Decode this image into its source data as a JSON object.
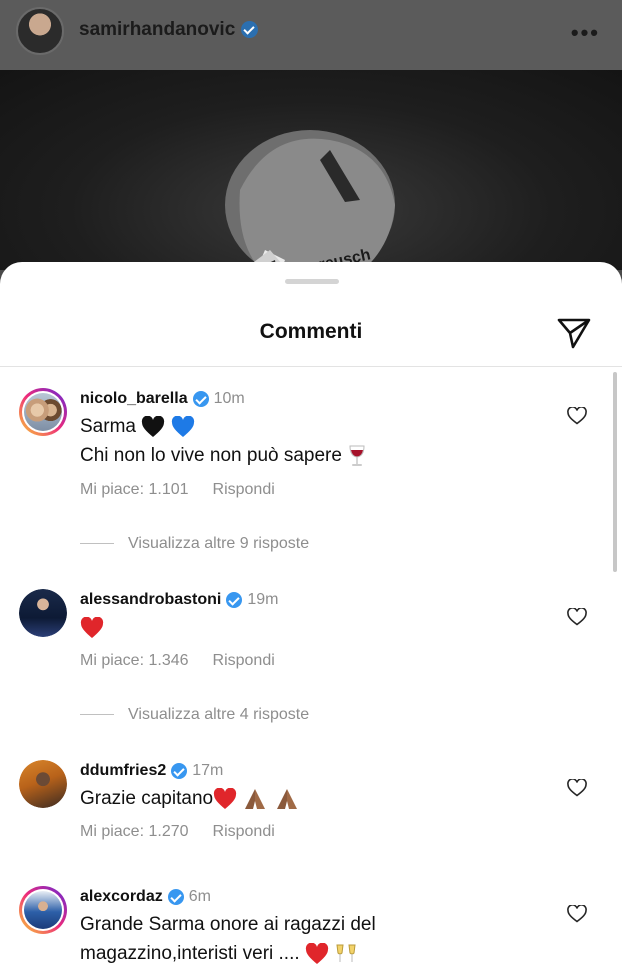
{
  "post": {
    "username": "samirhandanovic",
    "more": "•••",
    "glove_brand": "reusch"
  },
  "sheet": {
    "title": "Commenti"
  },
  "comments": [
    {
      "user": "nicolo_barella",
      "time": "10m",
      "line1": "Sarma",
      "line2": "Chi non lo vive non può sapere",
      "likes": "Mi piace: 1.101",
      "reply": "Rispondi",
      "view_replies": "Visualizza altre 9 risposte"
    },
    {
      "user": "alessandrobastoni",
      "time": "19m",
      "likes": "Mi piace: 1.346",
      "reply": "Rispondi",
      "view_replies": "Visualizza altre 4 risposte"
    },
    {
      "user": "ddumfries2",
      "time": "17m",
      "line1": "Grazie capitano",
      "likes": "Mi piace: 1.270",
      "reply": "Rispondi"
    },
    {
      "user": "alexcordaz",
      "time": "6m",
      "line1": "Grande Sarma onore ai ragazzi del",
      "line2": "magazzino,interisti veri ...."
    }
  ],
  "colors": {
    "verified": "#3897f0",
    "muted": "#8e8e8e",
    "heart_red": "#e0262b",
    "heart_blue": "#1e7ae6"
  },
  "icons": [
    "more-icon",
    "send-icon",
    "heart-outline-icon",
    "verified-icon"
  ]
}
